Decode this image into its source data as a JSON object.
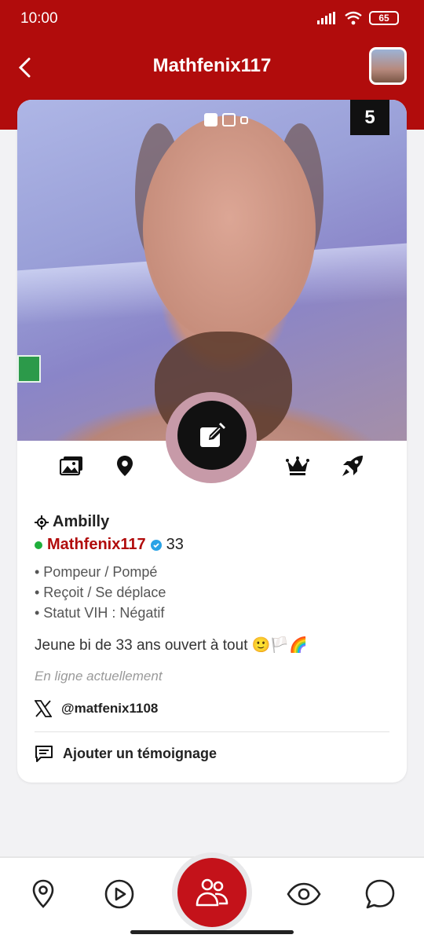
{
  "status_bar": {
    "time": "10:00",
    "battery": "65"
  },
  "header": {
    "title": "Mathfenix117"
  },
  "photo": {
    "active_index": 1,
    "total_dots": 3,
    "count_badge": "5"
  },
  "action_icons": [
    "gallery-icon",
    "location-pin-icon",
    "crown-icon",
    "rocket-icon"
  ],
  "profile": {
    "city": "Ambilly",
    "username": "Mathfenix117",
    "age": "33",
    "online_color": "#1fae3b",
    "tags": [
      "• Pompeur / Pompé",
      "• Reçoit / Se déplace",
      "• Statut VIH : Négatif"
    ],
    "bio": "Jeune bi de 33 ans ouvert à tout 🙂🏳️🌈",
    "status": "En ligne actuellement",
    "twitter_handle": "@matfenix1108",
    "testimony_label": "Ajouter un témoignage"
  },
  "colors": {
    "brand": "#b10c0c",
    "accent_red": "#c4121a",
    "verified": "#29a3e6"
  },
  "bottom_nav": [
    "map-pin-icon",
    "play-icon",
    "community-icon",
    "eye-icon",
    "chat-icon"
  ]
}
